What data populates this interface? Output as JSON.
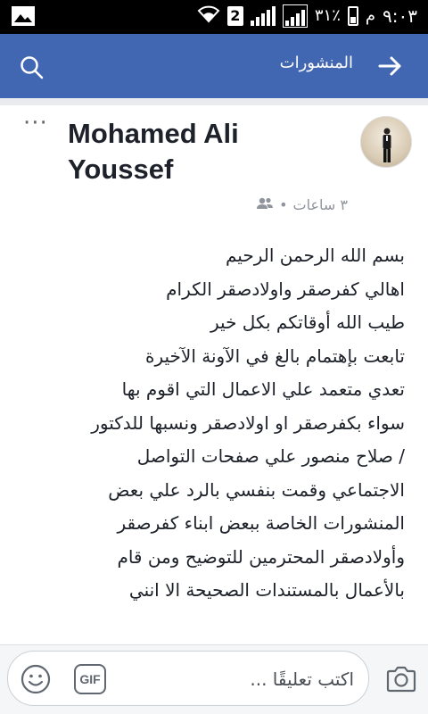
{
  "status_bar": {
    "time": "٩:٠٣",
    "ampm": "م",
    "battery": "٣١٪",
    "sim_slot": "2"
  },
  "header": {
    "title": "المنشورات"
  },
  "post": {
    "author": "Mohamed Ali Youssef",
    "time": "٣ ساعات",
    "lines": [
      "بسم الله الرحمن الرحيم",
      "اهالي كفرصقر واولادصقر الكرام",
      "طيب الله أوقاتكم بكل خير",
      "تابعت بإهتمام بالغ في الآونة الآخيرة",
      "تعدي متعمد علي الاعمال التي اقوم بها",
      "سواء بكفرصقر او اولادصقر ونسبها للدكتور",
      "/ صلاح منصور علي صفحات التواصل",
      "الاجتماعي وقمت بنفسي بالرد علي بعض",
      "المنشورات الخاصة ببعض ابناء كفرصقر",
      "وأولادصقر المحترمين للتوضيح ومن قام",
      "بالأعمال بالمستندات الصحيحة  الا انني"
    ]
  },
  "comment_bar": {
    "placeholder": "اكتب تعليقًا ...",
    "gif_label": "GIF"
  },
  "colors": {
    "header_bg": "#4267b2",
    "text": "#1d2129",
    "meta": "#90949c"
  }
}
